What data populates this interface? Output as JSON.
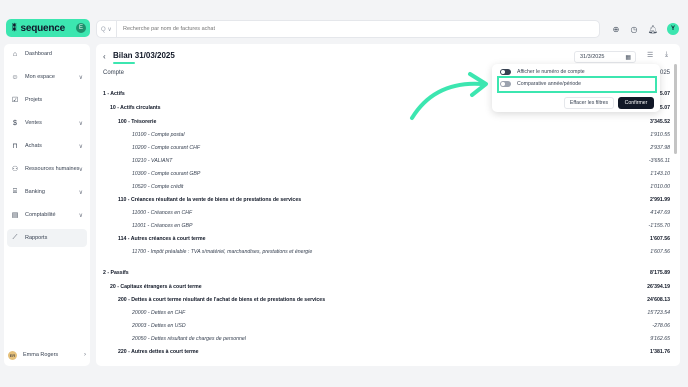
{
  "brand": {
    "name": "sequence",
    "badge": "E"
  },
  "search": {
    "placeholder": "Recherche par nom de factures achat",
    "selector": "Q ∨"
  },
  "topbar": {
    "avatar": "Y",
    "icons": [
      "add-icon",
      "clock-icon",
      "bell-icon"
    ]
  },
  "sidebar": {
    "items": [
      {
        "label": "Dashboard",
        "icon": "dashboard-icon",
        "chevron": false,
        "active": false
      },
      {
        "label": "Mon espace",
        "icon": "user-icon",
        "chevron": true,
        "active": false
      },
      {
        "label": "Projets",
        "icon": "check-icon",
        "chevron": false,
        "active": false
      },
      {
        "label": "Ventes",
        "icon": "sales-icon",
        "chevron": true,
        "active": false
      },
      {
        "label": "Achats",
        "icon": "cart-icon",
        "chevron": true,
        "active": false
      },
      {
        "label": "Ressources humaines",
        "icon": "people-icon",
        "chevron": true,
        "active": false
      },
      {
        "label": "Banking",
        "icon": "bank-icon",
        "chevron": true,
        "active": false
      },
      {
        "label": "Comptabilité",
        "icon": "ledger-icon",
        "chevron": true,
        "active": false
      },
      {
        "label": "Rapports",
        "icon": "chart-icon",
        "chevron": false,
        "active": true
      }
    ],
    "user": {
      "name": "Emma Rogers",
      "initials": "ER"
    }
  },
  "report": {
    "title": "Bilan 31/03/2025",
    "date_value": "31/3/2025",
    "col_account": "Compte",
    "col_date": "31/03/2025",
    "rows": [
      {
        "level": 0,
        "label": "1 - Actifs",
        "value": "88'175.07"
      },
      {
        "level": 1,
        "label": "10 - Actifs circulants",
        "value": "88'175.07"
      },
      {
        "level": 2,
        "label": "100 - Trésorerie",
        "value": "3'345.52"
      },
      {
        "level": 3,
        "label": "10100 - Compte postal",
        "value": "1'910.55"
      },
      {
        "level": 3,
        "label": "10200 - Compte courant CHF",
        "value": "2'937.98"
      },
      {
        "level": 3,
        "label": "10210 - VALIANT",
        "value": "-3'656.11"
      },
      {
        "level": 3,
        "label": "10300 - Compte courant GBP",
        "value": "1'143.10"
      },
      {
        "level": 3,
        "label": "10520 - Compte crédit",
        "value": "1'010.00"
      },
      {
        "level": 2,
        "label": "110 - Créances résultant de la vente de biens et de prestations de services",
        "value": "2'991.99"
      },
      {
        "level": 3,
        "label": "11000 - Créances en CHF",
        "value": "4'147.69"
      },
      {
        "level": 3,
        "label": "11001 - Créances en GBP",
        "value": "-1'155.70"
      },
      {
        "level": 2,
        "label": "114 - Autres créances à court terme",
        "value": "1'607.56"
      },
      {
        "level": 3,
        "label": "11700 - Impôt préalable : TVA s/matériel, marchandises, prestations et énergie",
        "value": "1'607.56"
      },
      {
        "level": 0,
        "label": "2 - Passifs",
        "value": "8'175.89"
      },
      {
        "level": 1,
        "label": "20 - Capitaux étrangers à court terme",
        "value": "26'394.19"
      },
      {
        "level": 2,
        "label": "200 - Dettes à court terme résultant de l'achat de biens et de prestations de services",
        "value": "24'608.13"
      },
      {
        "level": 3,
        "label": "20000 - Dettes en CHF",
        "value": "15'723.54"
      },
      {
        "level": 3,
        "label": "20003 - Dettes en USD",
        "value": "-278.06"
      },
      {
        "level": 3,
        "label": "20050 - Dettes résultant de charges de personnel",
        "value": "9'162.65"
      },
      {
        "level": 2,
        "label": "220 - Autres dettes à court terme",
        "value": "1'381.76"
      }
    ]
  },
  "popover": {
    "show_number": "Afficher le numéro de compte",
    "comparative": "Comparative année/période",
    "clear": "Effacer les filtres",
    "confirm": "Confirmer"
  },
  "colors": {
    "accent": "#3ce6b0",
    "dark": "#111827"
  }
}
